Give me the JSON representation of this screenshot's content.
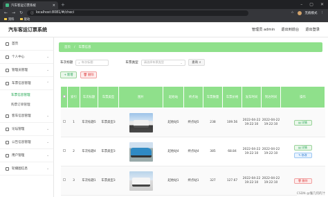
{
  "browser": {
    "tab_title": "汽车客运订票系统",
    "url": "localhost:8081/#/checi",
    "profile_label": "无痕模式",
    "bookmarks": [
      "资料",
      "驱动"
    ]
  },
  "header": {
    "app_title": "汽车客运订票系统",
    "user_label": "管理员 admin",
    "links": [
      "退出到前台",
      "退出登录"
    ]
  },
  "sidebar": {
    "items": [
      {
        "label": "首页",
        "icon": "home-icon",
        "expandable": false
      },
      {
        "label": "个人中心",
        "icon": "user-icon",
        "expandable": true
      },
      {
        "label": "管理员管理",
        "icon": "admin-icon",
        "expandable": true
      },
      {
        "label": "车票信息管理",
        "icon": "ticket-icon",
        "expandable": true,
        "open": true,
        "children": [
          "车票信息管理",
          "购票订单管理"
        ]
      },
      {
        "label": "客车信息管理",
        "icon": "bus-icon",
        "expandable": true
      },
      {
        "label": "论坛管理",
        "icon": "forum-icon",
        "expandable": true
      },
      {
        "label": "公告信息管理",
        "icon": "notice-icon",
        "expandable": true
      },
      {
        "label": "用户管理",
        "icon": "users-icon",
        "expandable": true
      },
      {
        "label": "轮播图信息",
        "icon": "image-icon",
        "expandable": true
      }
    ]
  },
  "breadcrumb": [
    "首页",
    "车票信息"
  ],
  "filters": {
    "field1_label": "车次标题",
    "field1_placeholder": "车次标题",
    "field2_label": "车票类型",
    "field2_placeholder": "请选择车票类型",
    "search_label": "查询"
  },
  "actions": {
    "add_label": "新增",
    "delete_label": "删除"
  },
  "table": {
    "headers": [
      "",
      "索引",
      "车次标题",
      "车票类型",
      "图片",
      "起始站",
      "终点站",
      "车票数量",
      "车票价格",
      "发车时间",
      "到达时间",
      "操作"
    ],
    "rows": [
      {
        "index": "1",
        "title": "车次标题5",
        "type": "车票类型3",
        "start": "起始站5",
        "end": "终点站5",
        "qty": "238",
        "price": "109.56",
        "depart": "2022-04-22 19:22:10",
        "arrive": "2022-04-22 19:22:10"
      },
      {
        "index": "2",
        "title": "车次标题4",
        "type": "车票类型3",
        "start": "起始站4",
        "end": "终点站4",
        "qty": "385",
        "price": "68.84",
        "depart": "2022-04-22 19:22:10",
        "arrive": "2022-04-22 19:22:10"
      },
      {
        "index": "3",
        "title": "车次标题1",
        "type": "车票类型3",
        "start": "起始站1",
        "end": "终点站1",
        "qty": "327",
        "price": "127.67",
        "depart": "2022-04-22 19:22:10",
        "arrive": "2022-04-22 19:22:10"
      }
    ],
    "op_labels": {
      "detail": "详情",
      "edit": "修改",
      "delete": "删除"
    }
  },
  "watermark": "CSDN @懂几何的汁"
}
